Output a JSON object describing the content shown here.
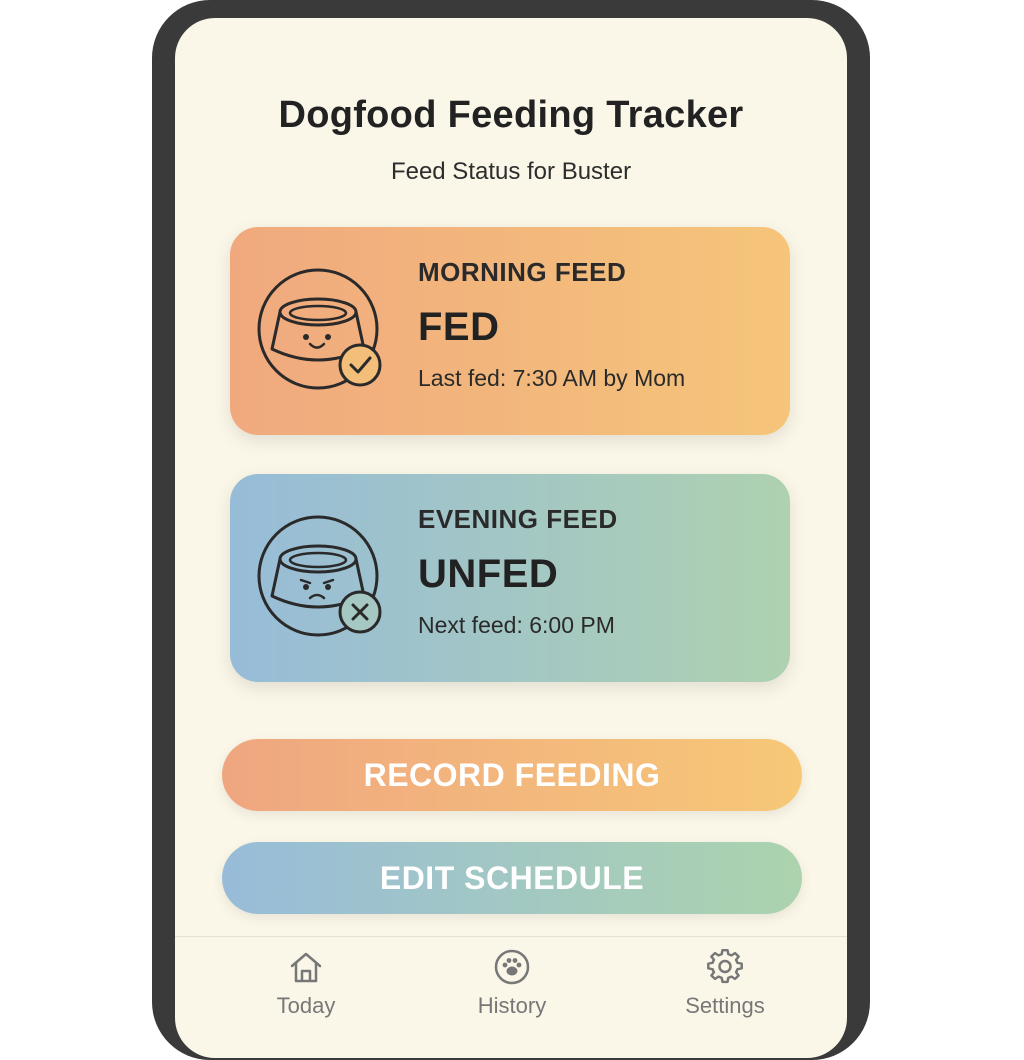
{
  "app": {
    "title": "Dogfood Feeding Tracker",
    "subtitle": "Feed Status for Buster"
  },
  "cards": {
    "morning": {
      "label": "MORNING FEED",
      "status": "FED",
      "detail": "Last fed: 7:30 AM by Mom",
      "icon": "happy-bowl-check-icon"
    },
    "evening": {
      "label": "EVENING FEED",
      "status": "UNFED",
      "detail": "Next feed: 6:00 PM",
      "icon": "sad-bowl-x-icon"
    }
  },
  "actions": {
    "record_label": "RECORD FEEDING",
    "edit_label": "EDIT SCHEDULE"
  },
  "tabs": [
    {
      "label": "Today",
      "icon": "home-icon"
    },
    {
      "label": "History",
      "icon": "paw-icon"
    },
    {
      "label": "Settings",
      "icon": "gear-icon"
    }
  ],
  "colors": {
    "screen_bg": "#faf6e8",
    "warm_start": "#f0a97e",
    "warm_end": "#f5c57a",
    "cool_start": "#97bcd8",
    "cool_end": "#aed1b0",
    "text_dark": "#222222",
    "tab_text": "#777777"
  }
}
